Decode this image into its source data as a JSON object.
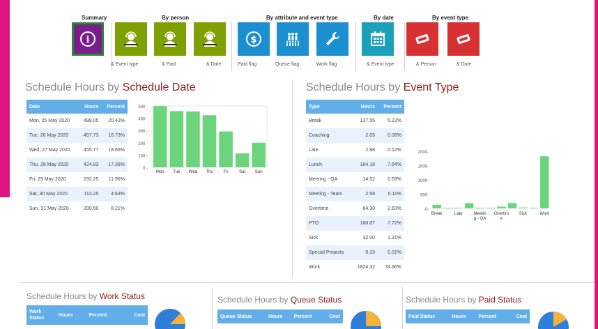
{
  "toolbar": {
    "groups": [
      {
        "title": "Summary"
      },
      {
        "title": "By person"
      },
      {
        "title": "By attribute and event type"
      },
      {
        "title": "By date"
      },
      {
        "title": "By event type"
      }
    ],
    "tiles": [
      {
        "icon": "info-icon",
        "color": "#7b1d8c",
        "sub": ""
      },
      {
        "icon": "person-headset-icon",
        "color": "#7ea000",
        "sub": "& Event type"
      },
      {
        "icon": "person-headset-icon",
        "color": "#7ea000",
        "sub": "& Paid"
      },
      {
        "icon": "person-headset-icon",
        "color": "#7ea000",
        "sub": "& Date"
      },
      {
        "icon": "dollar-icon",
        "color": "#1c8fd1",
        "sub": "Paid flag"
      },
      {
        "icon": "queue-people-icon",
        "color": "#1c8fd1",
        "sub": "Queue flag"
      },
      {
        "icon": "wrench-icon",
        "color": "#1c8fd1",
        "sub": "Work flag"
      },
      {
        "icon": "calendar-icon",
        "color": "#1ba0b9",
        "sub": "& Event type"
      },
      {
        "icon": "ticket-icon",
        "color": "#d73133",
        "sub": "& Person"
      },
      {
        "icon": "ticket-icon",
        "color": "#d73133",
        "sub": "& Date"
      }
    ]
  },
  "date_section": {
    "title_prefix": "Schedule Hours by",
    "title_highlight": "Schedule Date",
    "headers": [
      "Date",
      "Hours",
      "Percent"
    ],
    "rows": [
      [
        "Mon, 25 May 2020",
        "499.05",
        "20.42%"
      ],
      [
        "Tue, 26 May 2020",
        "457.73",
        "18.73%"
      ],
      [
        "Wed, 27 May 2020",
        "455.77",
        "18.65%"
      ],
      [
        "Thu, 28 May 2020",
        "424.83",
        "17.39%"
      ],
      [
        "Fri, 29 May 2020",
        "292.25",
        "11.96%"
      ],
      [
        "Sat, 30 May 2020",
        "113.25",
        "4.63%"
      ],
      [
        "Sun, 31 May 2020",
        "200.50",
        "8.21%"
      ]
    ]
  },
  "event_section": {
    "title_prefix": "Schedule Hours by",
    "title_highlight": "Event Type",
    "headers": [
      "Type",
      "Hours",
      "Percent"
    ],
    "rows": [
      [
        "Break",
        "127.55",
        "5.22%"
      ],
      [
        "Coaching",
        "2.05",
        "0.08%"
      ],
      [
        "Late",
        "2.88",
        "0.12%"
      ],
      [
        "Lunch",
        "184.18",
        "7.54%"
      ],
      [
        "Meeting - QA",
        "14.52",
        "0.59%"
      ],
      [
        "Meeting - Team",
        "2.58",
        "0.11%"
      ],
      [
        "Overtime",
        "64.30",
        "2.63%"
      ],
      [
        "PTO",
        "188.67",
        "7.72%"
      ],
      [
        "Sick",
        "32.00",
        "1.31%"
      ],
      [
        "Special Projects",
        "0.33",
        "0.01%"
      ],
      [
        "Work",
        "1824.32",
        "74.66%"
      ]
    ]
  },
  "bottom": {
    "work": {
      "title_prefix": "Schedule Hours by",
      "title_highlight": "Work Status",
      "headers": [
        "Work Status",
        "Hours",
        "Percent",
        "Cost"
      ]
    },
    "queue": {
      "title_prefix": "Schedule Hours by",
      "title_highlight": "Queue Status",
      "headers": [
        "Queue Status",
        "Hours",
        "Percent",
        "Cost"
      ]
    },
    "paid": {
      "title_prefix": "Schedule Hours by",
      "title_highlight": "Paid Status",
      "headers": [
        "Paid Status",
        "Hours",
        "Percent",
        "Cost"
      ]
    }
  },
  "colors": {
    "bar": "#6dd47e",
    "accent": "#8b1a1a",
    "header": "#62aee8",
    "pie_blue": "#2f7fd8",
    "pie_orange": "#f5b33b"
  },
  "chart_data": [
    {
      "type": "bar",
      "categories": [
        "Mon",
        "Tue",
        "Wed",
        "Thu",
        "Fri",
        "Sat",
        "Sun"
      ],
      "values": [
        499.05,
        457.73,
        455.77,
        424.83,
        292.25,
        113.25,
        200.5
      ],
      "yticks": [
        "500",
        "400",
        "300",
        "200",
        "100",
        "0"
      ],
      "ylim": [
        0,
        500
      ]
    },
    {
      "type": "bar",
      "categories": [
        "Break",
        "Late",
        "Meetin g - QA",
        "Overtim e",
        "Sick",
        "Work"
      ],
      "values": [
        127.55,
        2.05,
        2.88,
        184.18,
        14.52,
        2.58,
        64.3,
        188.67,
        32.0,
        0.33,
        1824.32
      ],
      "yticks": [
        "2000",
        "1500",
        "1000",
        "500",
        "0"
      ],
      "ylim": [
        0,
        2000
      ]
    }
  ]
}
